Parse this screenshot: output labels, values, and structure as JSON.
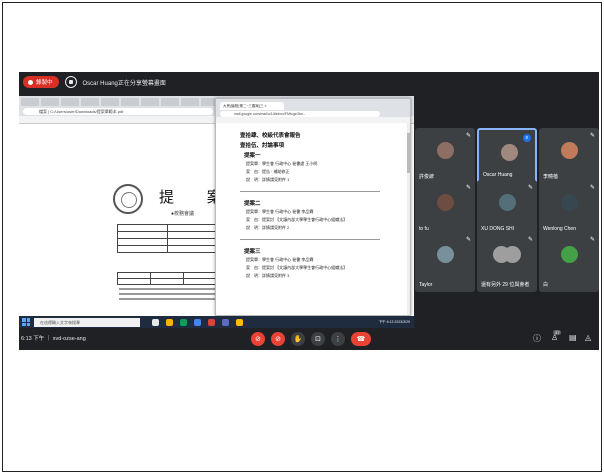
{
  "banner": {
    "rec_label": "錄製中",
    "presenter_text": "Oscar Huang正在分享螢幕畫面"
  },
  "pdf_window": {
    "address": "檔案 | C:/Users/user/Downloads/提案單範本.pdf",
    "heading": "提 案",
    "subheading": "●校務會議"
  },
  "gmail_window": {
    "tab_title": "大會(議程)第二~三審案(三 ×",
    "address": "mail.google.com/mail/u/1/#inbox/FMfcgzGtw...",
    "lines": [
      {
        "kind": "title",
        "text": "壹拾肆、校級代表會報告"
      },
      {
        "kind": "title",
        "text": "壹拾伍、討論事項"
      },
      {
        "kind": "title",
        "text": "提案一"
      },
      {
        "kind": "line",
        "text": "提案單：學生會 行政中心 秘書處 王小明"
      },
      {
        "kind": "line",
        "text": "案　由：提告 · 補助修正"
      },
      {
        "kind": "line",
        "text": "說　明：詳情請見附件 1"
      },
      {
        "kind": "title",
        "text": "提案二"
      },
      {
        "kind": "line",
        "text": "提案單：學生會 行政中心 秘書 李品霖"
      },
      {
        "kind": "line",
        "text": "案　由：提案討 【文讓內部大學學生會行政中心組織法】"
      },
      {
        "kind": "line",
        "text": "說　明：詳情請見附件 2"
      },
      {
        "kind": "title",
        "text": "提案三"
      },
      {
        "kind": "line",
        "text": "提案單：學生會 行政中心 秘書 李品霖"
      },
      {
        "kind": "line",
        "text": "案　由：提案討 【文讓內部大學學生會行政中心組織法】"
      },
      {
        "kind": "line",
        "text": "說　明：詳情請見附件 3"
      }
    ]
  },
  "taskbar": {
    "search_placeholder": "在這裡輸入文字來搜尋",
    "clock": "下午 6:13 2023/3/29"
  },
  "participants": [
    {
      "name": "許俊諺",
      "color": "#8d6e63"
    },
    {
      "name": "Oscar Huang",
      "color": "#a1887f"
    },
    {
      "name": "李曉蓓",
      "color": "#c17a5a"
    },
    {
      "name": "to fu",
      "color": "#6d4c41"
    },
    {
      "name": "XU DONG SHI",
      "color": "#546e7a"
    },
    {
      "name": "Wenlong Chen",
      "color": "#37474f"
    },
    {
      "name": "Taylor",
      "color": "#78909c"
    },
    {
      "name": "還有另外 29 位與會者",
      "color": "#9e9e9e"
    },
    {
      "name": "白",
      "color": "#43a047"
    }
  ],
  "bottombar": {
    "meeting_info": "6:13 下午 ｜ xvd-ozse-ang",
    "people_count": "37"
  },
  "colors": {
    "background": "#202124",
    "tile": "#3c4043",
    "danger": "#ea4335",
    "accent": "#8ab4f8"
  },
  "icons": [
    "record-icon",
    "present-icon",
    "mic-off-icon",
    "camera-off-icon",
    "hand-icon",
    "present-screen-icon",
    "more-icon",
    "hangup-icon",
    "info-icon",
    "people-icon",
    "chat-icon",
    "activities-icon"
  ]
}
